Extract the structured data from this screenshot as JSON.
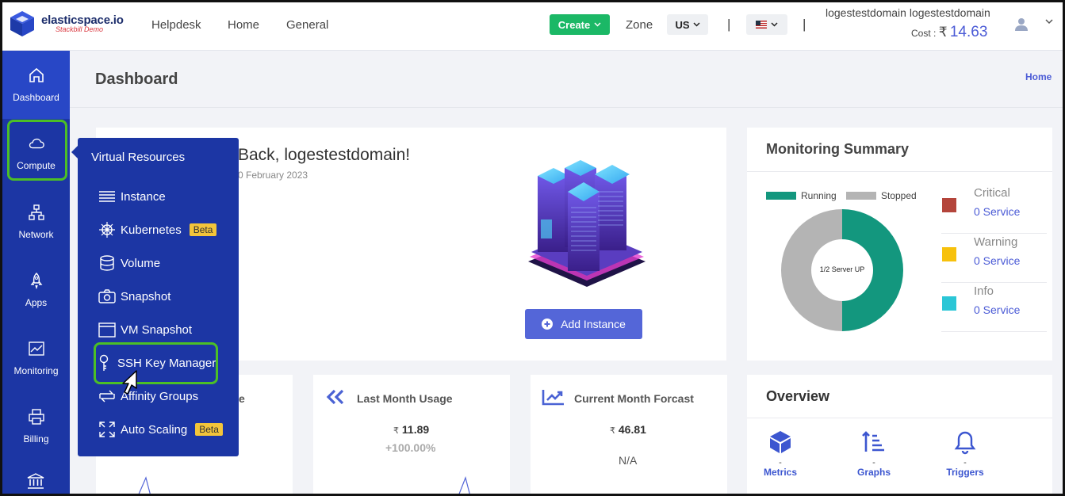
{
  "brand": {
    "name": "elasticspace.io",
    "tagline": "Stackbill Demo"
  },
  "top_nav": [
    "Helpdesk",
    "Home",
    "General"
  ],
  "create_button": "Create",
  "zone": {
    "label": "Zone",
    "value": "US"
  },
  "account": {
    "name": "logestestdomain logestestdomain",
    "cost_label": "Cost :",
    "currency": "₹",
    "cost_value": "14.63"
  },
  "sidebar": {
    "items": [
      {
        "label": "Dashboard",
        "icon": "home-icon"
      },
      {
        "label": "Compute",
        "icon": "cloud-icon"
      },
      {
        "label": "Network",
        "icon": "network-icon"
      },
      {
        "label": "Apps",
        "icon": "rocket-icon"
      },
      {
        "label": "Monitoring",
        "icon": "chart-icon"
      },
      {
        "label": "Billing",
        "icon": "printer-icon"
      }
    ]
  },
  "page": {
    "title": "Dashboard",
    "breadcrumb": "Home"
  },
  "welcome": {
    "title": "Back, logestestdomain!",
    "date": "0 February 2023",
    "add_button": "Add Instance"
  },
  "flyout": {
    "heading": "Virtual Resources",
    "items": [
      {
        "label": "Instance",
        "icon": "list-icon"
      },
      {
        "label": "Kubernetes",
        "icon": "helm-icon",
        "badge": "Beta"
      },
      {
        "label": "Volume",
        "icon": "database-icon"
      },
      {
        "label": "Snapshot",
        "icon": "camera-icon"
      },
      {
        "label": "VM Snapshot",
        "icon": "window-icon"
      },
      {
        "label": "SSH Key Manager",
        "icon": "key-icon"
      },
      {
        "label": "Affinity Groups",
        "icon": "swap-icon"
      },
      {
        "label": "Auto Scaling",
        "icon": "expand-icon",
        "badge": "Beta"
      }
    ]
  },
  "monitoring": {
    "title": "Monitoring Summary",
    "legend": [
      {
        "label": "Running",
        "color": "#13977e"
      },
      {
        "label": "Stopped",
        "color": "#b4b4b4"
      }
    ],
    "donut_label": "1/2 Server UP",
    "running_fraction": 0.5,
    "severity": [
      {
        "label": "Critical",
        "value": "0 Service",
        "color": "#b4453b"
      },
      {
        "label": "Warning",
        "value": "0 Service",
        "color": "#f7c10c"
      },
      {
        "label": "Info",
        "value": "0 Service",
        "color": "#2bc6d6"
      }
    ]
  },
  "stats": {
    "first_title_tail": "e",
    "last_month": {
      "title": "Last Month Usage",
      "currency": "₹",
      "value": "11.89",
      "change": "+100.00%"
    },
    "forecast": {
      "title": "Current Month Forcast",
      "currency": "₹",
      "value": "46.81",
      "note": "N/A"
    }
  },
  "overview": {
    "title": "Overview",
    "items": [
      {
        "label": "Metrics",
        "value": "-",
        "icon": "cube-icon"
      },
      {
        "label": "Graphs",
        "value": "-",
        "icon": "sort-icon"
      },
      {
        "label": "Triggers",
        "value": "-",
        "icon": "bell-icon"
      }
    ]
  },
  "colors": {
    "sidebar": "#1c36a4",
    "accent": "#4b5bd6",
    "create": "#1bb866",
    "highlight": "#4cbf26"
  }
}
